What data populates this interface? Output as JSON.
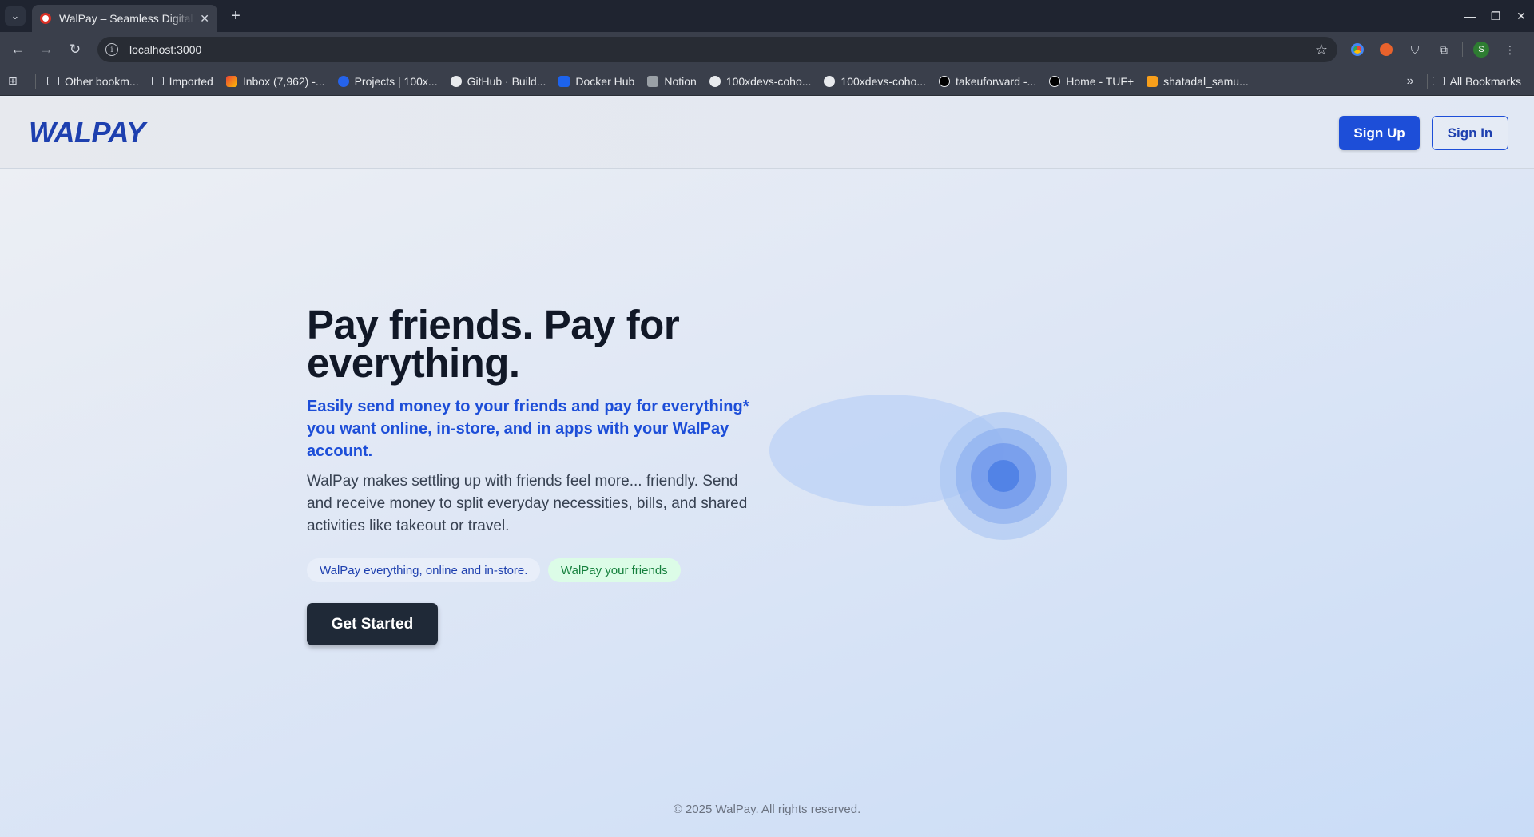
{
  "browser": {
    "tab_title": "WalPay – Seamless Digital Payments",
    "url": "localhost:3000",
    "icons": {
      "tab_list": "chevron-down-icon",
      "new_tab": "plus-icon",
      "back": "arrow-left-icon",
      "forward": "arrow-right-icon",
      "reload": "reload-icon",
      "bookmark_star": "star-icon"
    },
    "avatar_letter": "S",
    "bookmarks": [
      {
        "label": "Other bookm...",
        "icon": "folder-icon"
      },
      {
        "label": "Imported",
        "icon": "folder-icon"
      },
      {
        "label": "Inbox (7,962) -...",
        "icon": "gmail-icon"
      },
      {
        "label": "Projects | 100x...",
        "icon": "projects-icon"
      },
      {
        "label": "GitHub · Build...",
        "icon": "github-icon"
      },
      {
        "label": "Docker Hub",
        "icon": "docker-icon"
      },
      {
        "label": "Notion",
        "icon": "notion-icon"
      },
      {
        "label": "100xdevs-coho...",
        "icon": "github-icon"
      },
      {
        "label": "100xdevs-coho...",
        "icon": "github-icon"
      },
      {
        "label": "takeuforward -...",
        "icon": "tuf-icon"
      },
      {
        "label": "Home - TUF+",
        "icon": "tuf-icon"
      },
      {
        "label": "shatadal_samu...",
        "icon": "leetcode-icon"
      }
    ],
    "all_bookmarks": "All Bookmarks"
  },
  "navbar": {
    "logo": "WALPAY",
    "sign_up": "Sign Up",
    "sign_in": "Sign In"
  },
  "hero": {
    "title": "Pay friends. Pay for everything.",
    "subtitle": "Easily send money to your friends and pay for everything* you want online, in-store, and in apps with your WalPay account.",
    "description": "WalPay makes settling up with friends feel more... friendly. Send and receive money to split everyday necessities, bills, and shared activities like takeout or travel.",
    "pill_blue": "WalPay everything, online and in-store.",
    "pill_green": "WalPay your friends",
    "cta": "Get Started"
  },
  "colors": {
    "brand": "#1e40af",
    "primary_button": "#1d4ed8",
    "cta_button": "#1f2937",
    "green_pill_text": "#15803d"
  },
  "footer": {
    "text": "© 2025 WalPay. All rights reserved."
  }
}
